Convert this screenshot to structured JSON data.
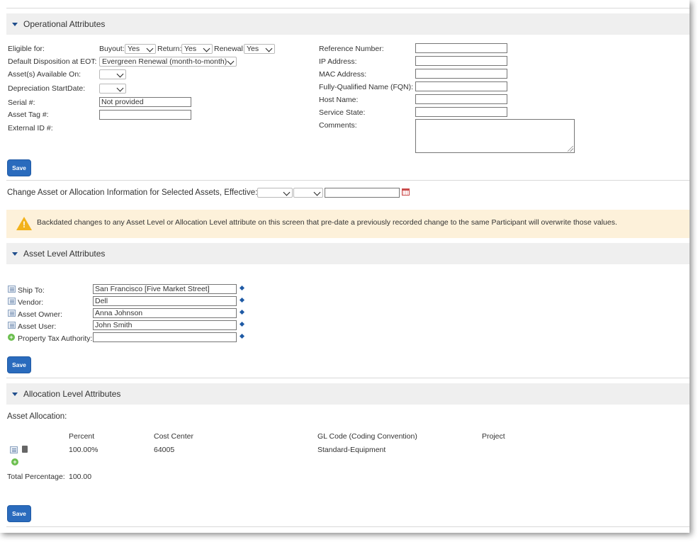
{
  "sections": {
    "operational": "Operational Attributes",
    "asset_level": "Asset Level Attributes",
    "allocation_level": "Allocation Level Attributes"
  },
  "operational": {
    "eligible_for_label": "Eligible for:",
    "buyout_label": "Buyout:",
    "buyout_value": "Yes",
    "return_label": "Return:",
    "return_value": "Yes",
    "renewal_label": "Renewal:",
    "renewal_value": "Yes",
    "default_disposition_label": "Default Disposition at EOT:",
    "default_disposition_value": "Evergreen Renewal (month-to-month)",
    "assets_available_label": "Asset(s) Available On:",
    "depreciation_label": "Depreciation StartDate:",
    "serial_label": "Serial #:",
    "serial_value": "Not provided",
    "asset_tag_label": "Asset Tag #:",
    "external_id_label": "External ID #:",
    "reference_number_label": "Reference Number:",
    "ip_address_label": "IP Address:",
    "mac_address_label": "MAC Address:",
    "fqn_label": "Fully-Qualified Name (FQN):",
    "host_name_label": "Host Name:",
    "service_state_label": "Service State:",
    "comments_label": "Comments:",
    "save_label": "Save"
  },
  "change_effective": {
    "label": "Change Asset or Allocation Information for Selected Assets, Effective:"
  },
  "warning": {
    "text": "Backdated changes to any Asset Level or Allocation Level attribute on this screen that pre-date a previously recorded change to the same Participant will overwrite those values."
  },
  "asset_level": {
    "fields": [
      {
        "label": "Ship To:",
        "value": "San Francisco [Five Market Street]"
      },
      {
        "label": "Vendor:",
        "value": "Dell"
      },
      {
        "label": "Asset Owner:",
        "value": "Anna Johnson"
      },
      {
        "label": "Asset User:",
        "value": "John Smith"
      },
      {
        "label": "Property Tax Authority:",
        "value": ""
      }
    ],
    "save_label": "Save"
  },
  "allocation": {
    "asset_allocation_label": "Asset Allocation:",
    "columns": [
      "Percent",
      "Cost Center",
      "GL Code (Coding Convention)",
      "Project"
    ],
    "rows": [
      {
        "percent": "100.00%",
        "cost_center": "64005",
        "gl_code": "Standard-Equipment",
        "project": ""
      }
    ],
    "total_label": "Total Percentage:",
    "total_value": "100.00",
    "save_label": "Save"
  },
  "colors": {
    "accent": "#2a6bbd",
    "section_bg": "#efefef",
    "warning_bg": "#fdf1da",
    "warning_icon": "#f2b21b"
  }
}
